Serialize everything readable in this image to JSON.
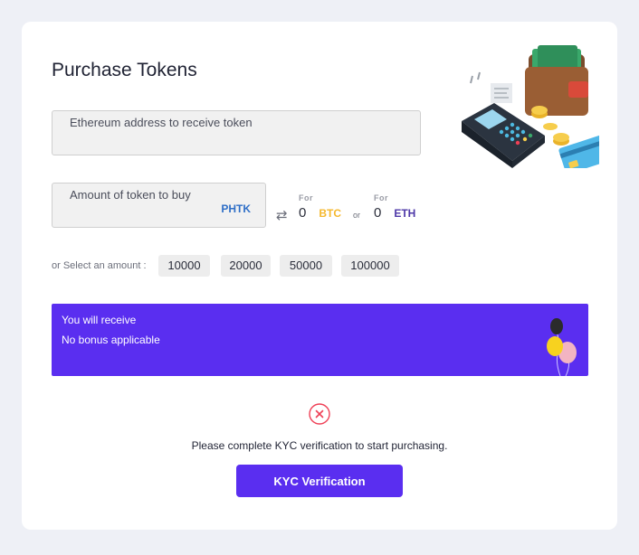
{
  "page": {
    "title": "Purchase Tokens"
  },
  "form": {
    "address_label": "Ethereum address to receive token",
    "amount_label": "Amount of token to buy",
    "token_symbol": "PHTK",
    "swap_glyph": "⇄"
  },
  "conversion": {
    "btc": {
      "for_label": "For",
      "value": "0",
      "currency": "BTC"
    },
    "or_label": "or",
    "eth": {
      "for_label": "For",
      "value": "0",
      "currency": "ETH"
    }
  },
  "quick_amounts": {
    "label": "or Select an amount :",
    "options": [
      "10000",
      "20000",
      "50000",
      "100000"
    ]
  },
  "bonus_banner": {
    "line1": "You will receive",
    "line2": "No bonus applicable"
  },
  "kyc": {
    "message": "Please complete KYC verification to start purchasing.",
    "button_label": "KYC Verification"
  },
  "colors": {
    "accent": "#5a2ef0",
    "btc": "#f5b82e",
    "eth": "#4e38a8",
    "token": "#2f6fc7",
    "error": "#ef4056"
  },
  "icons": [
    "wallet-payment-illustration",
    "swap-arrows-icon",
    "balloons-icon",
    "error-circle-x-icon"
  ]
}
